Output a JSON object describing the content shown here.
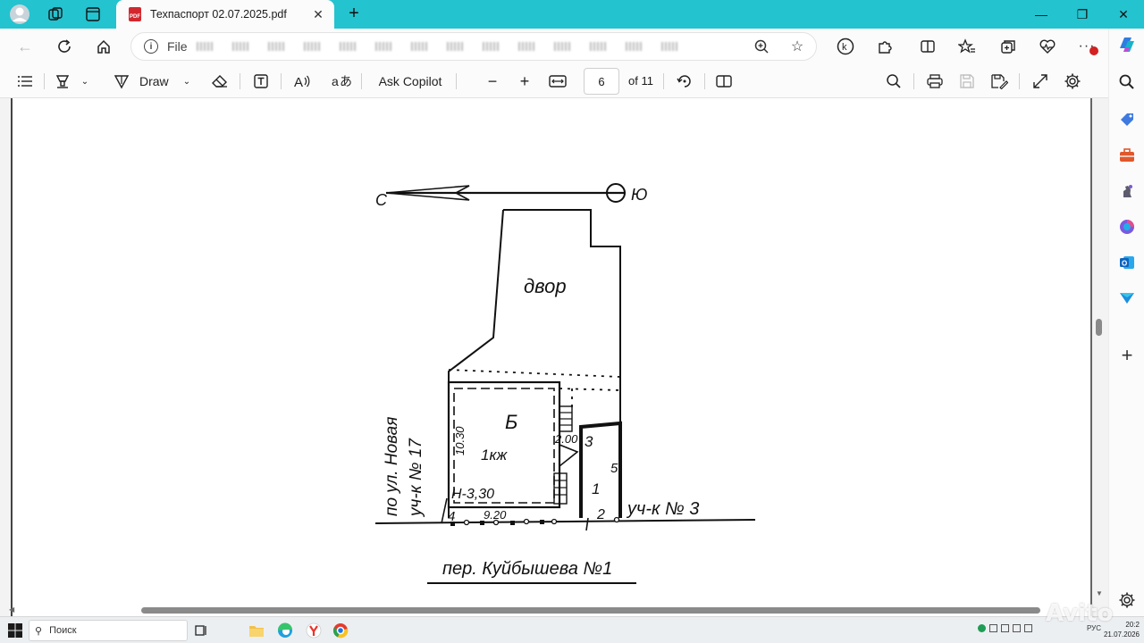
{
  "browser": {
    "tab_title": "Техпаспорт 02.07.2025.pdf",
    "pdf_badge": "PDF",
    "address_scheme": "File",
    "accent": "#23c3cf"
  },
  "pdf_toolbar": {
    "draw_label": "Draw",
    "ask_copilot_label": "Ask Copilot",
    "current_page": "6",
    "page_count_label": "of 11"
  },
  "plan": {
    "north_label": "С",
    "south_label": "Ю",
    "yard_label": "двор",
    "building_letter": "Б",
    "building_type": "1кж",
    "height_label": "Н-3,30",
    "width_dim": "10.30",
    "length_dim": "9.20",
    "stair_dim": "2.00",
    "point_1": "1",
    "point_2": "2",
    "point_3": "3",
    "point_4": "4",
    "point_5": "5",
    "left_street_line1": "по ул. Новая",
    "left_street_line2": "уч-к № 17",
    "neighbor_plot": "уч-к № 3",
    "bottom_street": "пер. Куйбышева №1"
  },
  "taskbar": {
    "search_placeholder": "Поиск",
    "lang": "РУС",
    "time": "20:2",
    "date": "21.07.2026",
    "watermark": "Avito"
  }
}
